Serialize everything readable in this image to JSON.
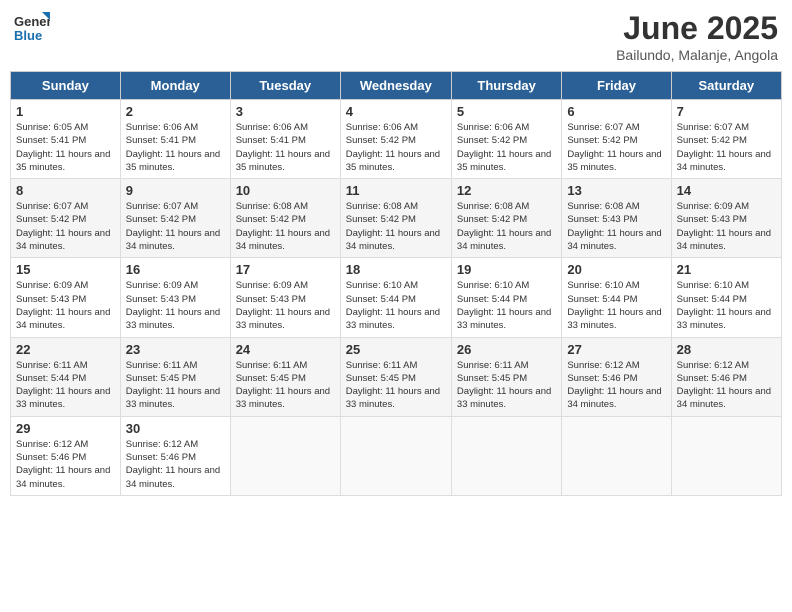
{
  "header": {
    "logo_general": "General",
    "logo_blue": "Blue",
    "title": "June 2025",
    "subtitle": "Bailundo, Malanje, Angola"
  },
  "calendar": {
    "days_of_week": [
      "Sunday",
      "Monday",
      "Tuesday",
      "Wednesday",
      "Thursday",
      "Friday",
      "Saturday"
    ],
    "weeks": [
      [
        {
          "day": "1",
          "sunrise": "6:05 AM",
          "sunset": "5:41 PM",
          "daylight": "11 hours and 35 minutes."
        },
        {
          "day": "2",
          "sunrise": "6:06 AM",
          "sunset": "5:41 PM",
          "daylight": "11 hours and 35 minutes."
        },
        {
          "day": "3",
          "sunrise": "6:06 AM",
          "sunset": "5:41 PM",
          "daylight": "11 hours and 35 minutes."
        },
        {
          "day": "4",
          "sunrise": "6:06 AM",
          "sunset": "5:42 PM",
          "daylight": "11 hours and 35 minutes."
        },
        {
          "day": "5",
          "sunrise": "6:06 AM",
          "sunset": "5:42 PM",
          "daylight": "11 hours and 35 minutes."
        },
        {
          "day": "6",
          "sunrise": "6:07 AM",
          "sunset": "5:42 PM",
          "daylight": "11 hours and 35 minutes."
        },
        {
          "day": "7",
          "sunrise": "6:07 AM",
          "sunset": "5:42 PM",
          "daylight": "11 hours and 34 minutes."
        }
      ],
      [
        {
          "day": "8",
          "sunrise": "6:07 AM",
          "sunset": "5:42 PM",
          "daylight": "11 hours and 34 minutes."
        },
        {
          "day": "9",
          "sunrise": "6:07 AM",
          "sunset": "5:42 PM",
          "daylight": "11 hours and 34 minutes."
        },
        {
          "day": "10",
          "sunrise": "6:08 AM",
          "sunset": "5:42 PM",
          "daylight": "11 hours and 34 minutes."
        },
        {
          "day": "11",
          "sunrise": "6:08 AM",
          "sunset": "5:42 PM",
          "daylight": "11 hours and 34 minutes."
        },
        {
          "day": "12",
          "sunrise": "6:08 AM",
          "sunset": "5:42 PM",
          "daylight": "11 hours and 34 minutes."
        },
        {
          "day": "13",
          "sunrise": "6:08 AM",
          "sunset": "5:43 PM",
          "daylight": "11 hours and 34 minutes."
        },
        {
          "day": "14",
          "sunrise": "6:09 AM",
          "sunset": "5:43 PM",
          "daylight": "11 hours and 34 minutes."
        }
      ],
      [
        {
          "day": "15",
          "sunrise": "6:09 AM",
          "sunset": "5:43 PM",
          "daylight": "11 hours and 34 minutes."
        },
        {
          "day": "16",
          "sunrise": "6:09 AM",
          "sunset": "5:43 PM",
          "daylight": "11 hours and 33 minutes."
        },
        {
          "day": "17",
          "sunrise": "6:09 AM",
          "sunset": "5:43 PM",
          "daylight": "11 hours and 33 minutes."
        },
        {
          "day": "18",
          "sunrise": "6:10 AM",
          "sunset": "5:44 PM",
          "daylight": "11 hours and 33 minutes."
        },
        {
          "day": "19",
          "sunrise": "6:10 AM",
          "sunset": "5:44 PM",
          "daylight": "11 hours and 33 minutes."
        },
        {
          "day": "20",
          "sunrise": "6:10 AM",
          "sunset": "5:44 PM",
          "daylight": "11 hours and 33 minutes."
        },
        {
          "day": "21",
          "sunrise": "6:10 AM",
          "sunset": "5:44 PM",
          "daylight": "11 hours and 33 minutes."
        }
      ],
      [
        {
          "day": "22",
          "sunrise": "6:11 AM",
          "sunset": "5:44 PM",
          "daylight": "11 hours and 33 minutes."
        },
        {
          "day": "23",
          "sunrise": "6:11 AM",
          "sunset": "5:45 PM",
          "daylight": "11 hours and 33 minutes."
        },
        {
          "day": "24",
          "sunrise": "6:11 AM",
          "sunset": "5:45 PM",
          "daylight": "11 hours and 33 minutes."
        },
        {
          "day": "25",
          "sunrise": "6:11 AM",
          "sunset": "5:45 PM",
          "daylight": "11 hours and 33 minutes."
        },
        {
          "day": "26",
          "sunrise": "6:11 AM",
          "sunset": "5:45 PM",
          "daylight": "11 hours and 33 minutes."
        },
        {
          "day": "27",
          "sunrise": "6:12 AM",
          "sunset": "5:46 PM",
          "daylight": "11 hours and 34 minutes."
        },
        {
          "day": "28",
          "sunrise": "6:12 AM",
          "sunset": "5:46 PM",
          "daylight": "11 hours and 34 minutes."
        }
      ],
      [
        {
          "day": "29",
          "sunrise": "6:12 AM",
          "sunset": "5:46 PM",
          "daylight": "11 hours and 34 minutes."
        },
        {
          "day": "30",
          "sunrise": "6:12 AM",
          "sunset": "5:46 PM",
          "daylight": "11 hours and 34 minutes."
        },
        null,
        null,
        null,
        null,
        null
      ]
    ]
  }
}
